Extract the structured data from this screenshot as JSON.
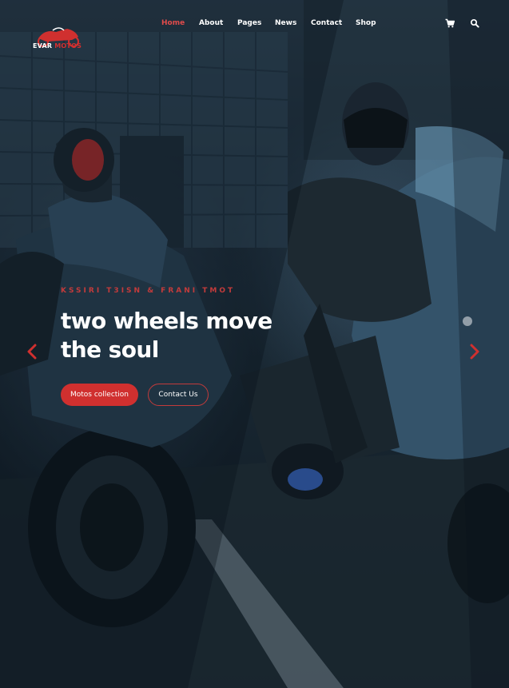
{
  "brand": {
    "name_part1": "EVAR",
    "name_part2": "MOTOS",
    "logo_icon": "motorcycle-logo-icon",
    "accent_color": "#d0302f"
  },
  "nav": {
    "items": [
      {
        "label": "Home",
        "active": true
      },
      {
        "label": "About",
        "active": false
      },
      {
        "label": "Pages",
        "active": false
      },
      {
        "label": "News",
        "active": false
      },
      {
        "label": "Contact",
        "active": false
      },
      {
        "label": "Shop",
        "active": false
      }
    ],
    "cart_icon": "cart-icon",
    "search_icon": "search-icon"
  },
  "hero": {
    "eyebrow": "KSSIRI T3ISN & FRANI TMOT",
    "headline": "two wheels move the soul",
    "primary_button": "Motos collection",
    "secondary_button": "Contact Us",
    "prev_icon": "chevron-left-icon",
    "next_icon": "chevron-right-icon"
  }
}
